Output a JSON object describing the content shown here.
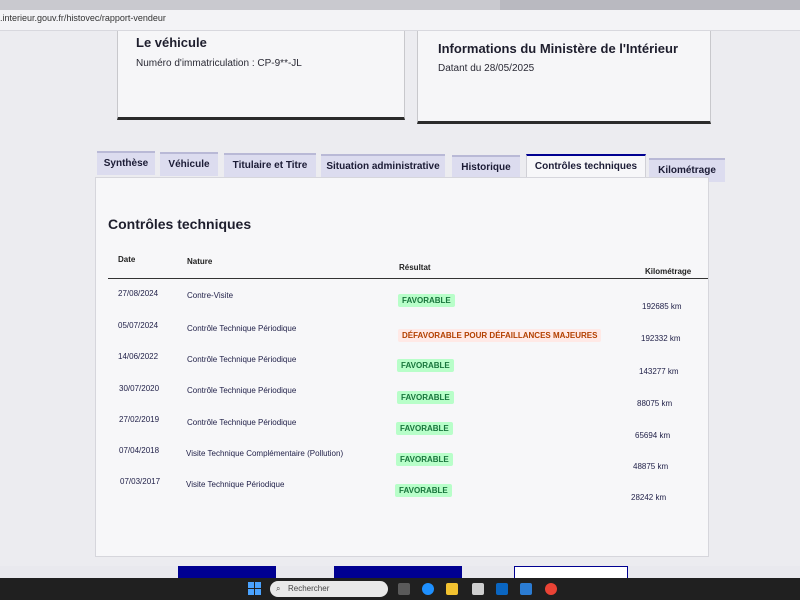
{
  "browser": {
    "url": ".interieur.gouv.fr/histovec/rapport-vendeur"
  },
  "vehicle_card": {
    "title": "Le véhicule",
    "plate_line": "Numéro d'immatriculation : CP-9**-JL"
  },
  "ministry_card": {
    "title": "Informations du Ministère de l'Intérieur",
    "date_line": "Datant du 28/05/2025"
  },
  "tabs": [
    {
      "label": "Synthèse"
    },
    {
      "label": "Véhicule"
    },
    {
      "label": "Titulaire et Titre"
    },
    {
      "label": "Situation administrative"
    },
    {
      "label": "Historique"
    },
    {
      "label": "Contrôles techniques",
      "active": true
    },
    {
      "label": "Kilométrage"
    }
  ],
  "section": {
    "title": "Contrôles techniques",
    "headers": {
      "date": "Date",
      "nature": "Nature",
      "result": "Résultat",
      "mileage": "Kilométrage"
    },
    "rows": [
      {
        "date": "27/08/2024",
        "nature": "Contre-Visite",
        "result": "FAVORABLE",
        "status": "ok",
        "mileage": "192685 km"
      },
      {
        "date": "05/07/2024",
        "nature": "Contrôle Technique Périodique",
        "result": "DÉFAVORABLE POUR DÉFAILLANCES MAJEURES",
        "status": "ko",
        "mileage": "192332 km"
      },
      {
        "date": "14/06/2022",
        "nature": "Contrôle Technique Périodique",
        "result": "FAVORABLE",
        "status": "ok",
        "mileage": "143277 km"
      },
      {
        "date": "30/07/2020",
        "nature": "Contrôle Technique Périodique",
        "result": "FAVORABLE",
        "status": "ok",
        "mileage": "88075 km"
      },
      {
        "date": "27/02/2019",
        "nature": "Contrôle Technique Périodique",
        "result": "FAVORABLE",
        "status": "ok",
        "mileage": "65694 km"
      },
      {
        "date": "07/04/2018",
        "nature": "Visite Technique Complémentaire (Pollution)",
        "result": "FAVORABLE",
        "status": "ok",
        "mileage": "48875 km"
      },
      {
        "date": "07/03/2017",
        "nature": "Visite Technique Périodique",
        "result": "FAVORABLE",
        "status": "ok",
        "mileage": "28242 km"
      }
    ]
  },
  "taskbar": {
    "search_placeholder": "Rechercher"
  },
  "colors": {
    "accent": "#000091",
    "favorable_bg": "#b8fec9",
    "favorable_fg": "#18753c",
    "defavorable_bg": "#ffe9e6",
    "defavorable_fg": "#b34000"
  }
}
